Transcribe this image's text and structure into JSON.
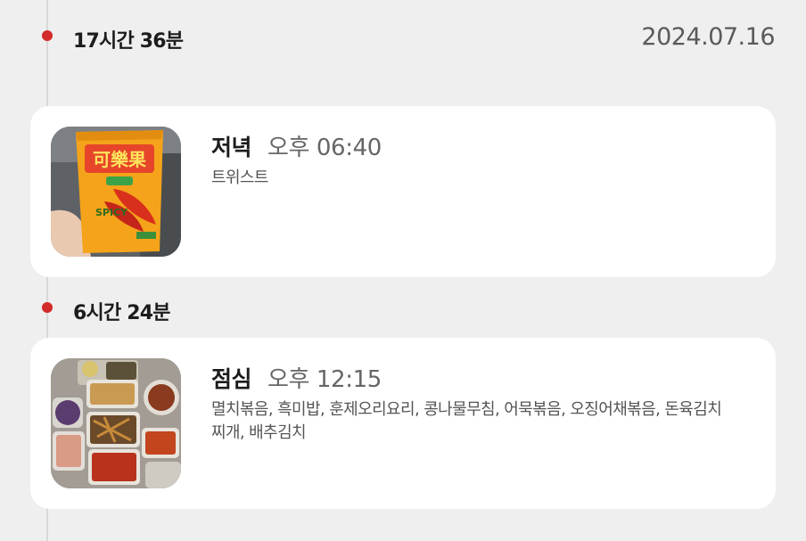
{
  "colors": {
    "accent_dot": "#d32a2a",
    "background": "#efefef",
    "card": "#ffffff"
  },
  "timeline": {
    "top_gap": "17시간 36분",
    "date": "2024.07.16",
    "middle_gap": "6시간 24분"
  },
  "meals": [
    {
      "type": "저녁",
      "time": "오후 06:40",
      "items": "트위스트",
      "photo_icon": "snack-bag-photo"
    },
    {
      "type": "점심",
      "time": "오후 12:15",
      "items": "멸치볶음, 흑미밥, 훈제오리요리, 콩나물무침, 어묵볶음, 오징어채볶음, 돈육김치찌개, 배추김치",
      "photo_icon": "meal-tray-photo"
    }
  ]
}
